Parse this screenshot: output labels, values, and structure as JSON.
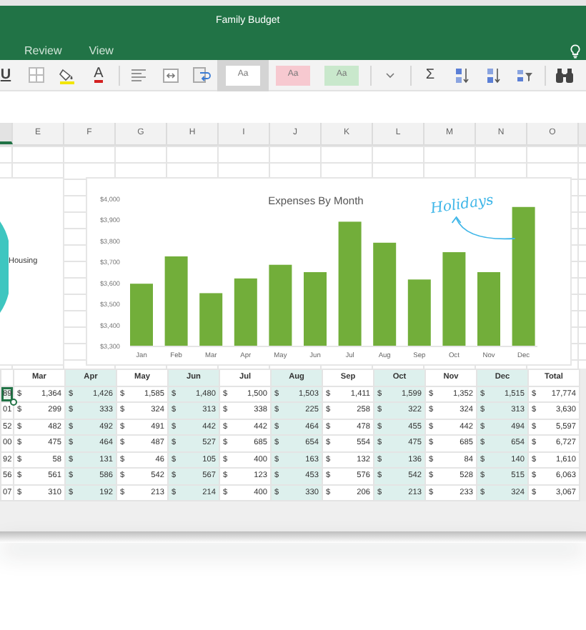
{
  "window": {
    "title": "Family Budget"
  },
  "tabs": [
    {
      "label": "Review",
      "selected": false
    },
    {
      "label": "View",
      "selected": false
    }
  ],
  "ribbon": [
    {
      "kind": "glyph",
      "text": "U"
    },
    {
      "kind": "borders"
    },
    {
      "kind": "fill"
    },
    {
      "kind": "fontcolor",
      "text": "A"
    },
    {
      "kind": "separator"
    },
    {
      "kind": "align"
    },
    {
      "kind": "merge"
    },
    {
      "kind": "wrap"
    },
    {
      "kind": "style",
      "text": "Aa",
      "color": "#ffffff",
      "selected": true
    },
    {
      "kind": "style",
      "text": "Aa",
      "color": "#f7c9d0",
      "selected": false
    },
    {
      "kind": "style",
      "text": "Aa",
      "color": "#c9e8cc",
      "selected": false
    },
    {
      "kind": "separator"
    },
    {
      "kind": "caret"
    },
    {
      "kind": "separator"
    },
    {
      "kind": "glyph",
      "text": "Σ"
    },
    {
      "kind": "sortaz"
    },
    {
      "kind": "sortza"
    },
    {
      "kind": "filter"
    },
    {
      "kind": "separator"
    },
    {
      "kind": "find"
    }
  ],
  "column_headers": [
    {
      "selected": true
    },
    {
      "label": "E",
      "selected": false
    },
    {
      "label": "F",
      "selected": false
    },
    {
      "label": "G",
      "selected": false
    },
    {
      "label": "H",
      "selected": false
    },
    {
      "label": "I",
      "selected": false
    },
    {
      "label": "J",
      "selected": false
    },
    {
      "label": "K",
      "selected": false
    },
    {
      "label": "L",
      "selected": false
    },
    {
      "label": "M",
      "selected": false
    },
    {
      "label": "N",
      "selected": false
    },
    {
      "label": "O",
      "selected": false
    }
  ],
  "left_chart": {
    "legend_labels": [
      "Housing"
    ]
  },
  "chart": {
    "chart_data": {
      "type": "bar",
      "title": "Expenses By Month",
      "categories": [
        "Jan",
        "Feb",
        "Mar",
        "Apr",
        "May",
        "Jun",
        "Jul",
        "Aug",
        "Sep",
        "Oct",
        "Nov",
        "Dec"
      ],
      "series": [
        {
          "color": "#72ae3a",
          "values": [
            3595,
            3725,
            3550,
            3620,
            3685,
            3650,
            3890,
            3790,
            3615,
            3745,
            3650,
            3960
          ]
        }
      ],
      "ylim": [
        3300,
        4000
      ],
      "yticks": [
        {
          "value": 3300,
          "label": "$3,300"
        },
        {
          "value": 3400,
          "label": "$3,400"
        },
        {
          "value": 3500,
          "label": "$3,500"
        },
        {
          "value": 3600,
          "label": "$3,600"
        },
        {
          "value": 3700,
          "label": "$3,700"
        },
        {
          "value": 3800,
          "label": "$3,800"
        },
        {
          "value": 3900,
          "label": "$3,900"
        },
        {
          "value": 4000,
          "label": "$4,000"
        }
      ],
      "annotations": [
        {
          "text": "Holidays",
          "x": "Dec"
        }
      ]
    }
  },
  "table": {
    "columns": [
      {
        "label": "Mar",
        "shaded": false
      },
      {
        "label": "Apr",
        "shaded": true
      },
      {
        "label": "May",
        "shaded": false
      },
      {
        "label": "Jun",
        "shaded": true
      },
      {
        "label": "Jul",
        "shaded": false
      },
      {
        "label": "Aug",
        "shaded": true
      },
      {
        "label": "Sep",
        "shaded": false
      },
      {
        "label": "Oct",
        "shaded": true
      },
      {
        "label": "Nov",
        "shaded": false
      },
      {
        "label": "Dec",
        "shaded": true
      },
      {
        "label": "Total",
        "shaded": false
      }
    ],
    "rows": [
      {
        "lead": {
          "text": "89",
          "selected": true
        },
        "values": [
          [
            "$",
            "1,364"
          ],
          [
            "$",
            "1,426"
          ],
          [
            "$",
            "1,585"
          ],
          [
            "$",
            "1,480"
          ],
          [
            "$",
            "1,500"
          ],
          [
            "$",
            "1,503"
          ],
          [
            "$",
            "1,411"
          ],
          [
            "$",
            "1,599"
          ],
          [
            "$",
            "1,352"
          ],
          [
            "$",
            "1,515"
          ],
          [
            "$",
            "17,774"
          ]
        ]
      },
      {
        "lead": {
          "text": "01",
          "selected": false
        },
        "values": [
          [
            "$",
            "299"
          ],
          [
            "$",
            "333"
          ],
          [
            "$",
            "324"
          ],
          [
            "$",
            "313"
          ],
          [
            "$",
            "338"
          ],
          [
            "$",
            "225"
          ],
          [
            "$",
            "258"
          ],
          [
            "$",
            "322"
          ],
          [
            "$",
            "324"
          ],
          [
            "$",
            "313"
          ],
          [
            "$",
            "3,630"
          ]
        ]
      },
      {
        "lead": {
          "text": "52",
          "selected": false
        },
        "values": [
          [
            "$",
            "482"
          ],
          [
            "$",
            "492"
          ],
          [
            "$",
            "491"
          ],
          [
            "$",
            "442"
          ],
          [
            "$",
            "442"
          ],
          [
            "$",
            "464"
          ],
          [
            "$",
            "478"
          ],
          [
            "$",
            "455"
          ],
          [
            "$",
            "442"
          ],
          [
            "$",
            "494"
          ],
          [
            "$",
            "5,597"
          ]
        ]
      },
      {
        "lead": {
          "text": "00",
          "selected": false
        },
        "values": [
          [
            "$",
            "475"
          ],
          [
            "$",
            "464"
          ],
          [
            "$",
            "487"
          ],
          [
            "$",
            "527"
          ],
          [
            "$",
            "685"
          ],
          [
            "$",
            "654"
          ],
          [
            "$",
            "554"
          ],
          [
            "$",
            "475"
          ],
          [
            "$",
            "685"
          ],
          [
            "$",
            "654"
          ],
          [
            "$",
            "6,727"
          ]
        ]
      },
      {
        "lead": {
          "text": "92",
          "selected": false
        },
        "values": [
          [
            "$",
            "58"
          ],
          [
            "$",
            "131"
          ],
          [
            "$",
            "46"
          ],
          [
            "$",
            "105"
          ],
          [
            "$",
            "400"
          ],
          [
            "$",
            "163"
          ],
          [
            "$",
            "132"
          ],
          [
            "$",
            "136"
          ],
          [
            "$",
            "84"
          ],
          [
            "$",
            "140"
          ],
          [
            "$",
            "1,610"
          ]
        ]
      },
      {
        "lead": {
          "text": "56",
          "selected": false
        },
        "values": [
          [
            "$",
            "561"
          ],
          [
            "$",
            "586"
          ],
          [
            "$",
            "542"
          ],
          [
            "$",
            "567"
          ],
          [
            "$",
            "123"
          ],
          [
            "$",
            "453"
          ],
          [
            "$",
            "576"
          ],
          [
            "$",
            "542"
          ],
          [
            "$",
            "528"
          ],
          [
            "$",
            "515"
          ],
          [
            "$",
            "6,063"
          ]
        ]
      },
      {
        "lead": {
          "text": "07",
          "selected": false
        },
        "values": [
          [
            "$",
            "310"
          ],
          [
            "$",
            "192"
          ],
          [
            "$",
            "213"
          ],
          [
            "$",
            "214"
          ],
          [
            "$",
            "400"
          ],
          [
            "$",
            "330"
          ],
          [
            "$",
            "206"
          ],
          [
            "$",
            "213"
          ],
          [
            "$",
            "233"
          ],
          [
            "$",
            "324"
          ],
          [
            "$",
            "3,067"
          ]
        ]
      }
    ]
  }
}
